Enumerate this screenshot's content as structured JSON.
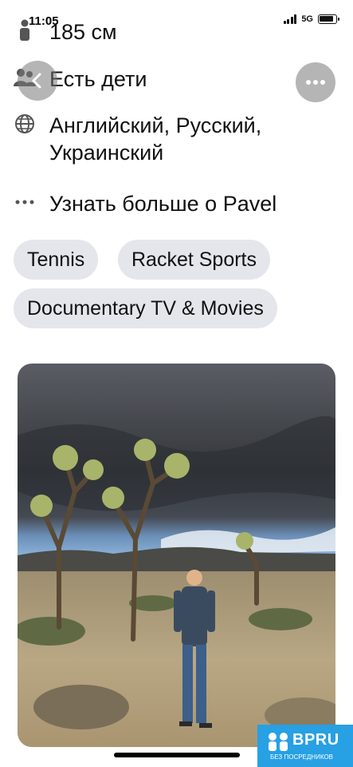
{
  "status_bar": {
    "time": "11:05",
    "network": "5G"
  },
  "profile": {
    "height": "185 см",
    "children": "Есть дети",
    "languages": "Английский, Русский, Украинский",
    "learn_more": "Узнать больше о Pavel"
  },
  "interests": [
    "Tennis",
    "Racket Sports",
    "Documentary TV & Movies"
  ],
  "watermark": {
    "brand": "BPRU",
    "subtitle": "БЕЗ ПОСРЕДНИКОВ"
  }
}
